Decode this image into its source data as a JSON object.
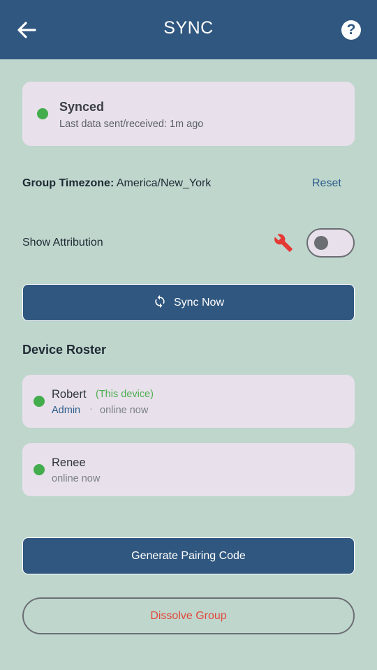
{
  "appbar": {
    "title": "SYNC",
    "back_icon": "arrow-left-icon",
    "help_icon": "help-circle-icon",
    "help_glyph": "?"
  },
  "status": {
    "title": "Synced",
    "subtitle": "Last data sent/received: 1m ago",
    "color": "#43ad4d"
  },
  "timezone": {
    "label": "Group Timezone:",
    "value": "America/New_York",
    "reset_label": "Reset"
  },
  "attribution": {
    "label": "Show Attribution",
    "icon": "wrench-icon",
    "enabled": false
  },
  "sync_button": {
    "label": "Sync Now",
    "icon": "sync-icon"
  },
  "roster": {
    "title": "Device Roster",
    "devices": [
      {
        "name": "Robert",
        "tag": "(This device)",
        "role": "Admin",
        "separator": "·",
        "status": "online now"
      },
      {
        "name": "Renee",
        "status": "online now"
      }
    ]
  },
  "actions": {
    "pair_label": "Generate Pairing Code",
    "dissolve_label": "Dissolve Group"
  },
  "colors": {
    "primary": "#30577f",
    "background": "#bfd6cd",
    "card": "#e8e0ea",
    "online": "#43ad4d",
    "danger": "#e0483a"
  }
}
